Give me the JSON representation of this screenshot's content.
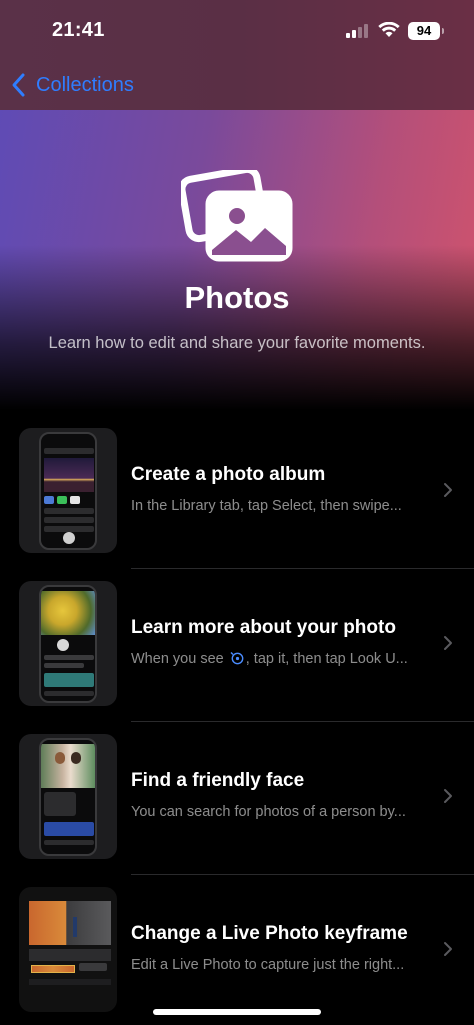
{
  "status_bar": {
    "time": "21:41",
    "battery_level": "94"
  },
  "nav": {
    "back_label": "Collections"
  },
  "hero": {
    "title": "Photos",
    "subtitle": "Learn how to edit and share your favorite moments.",
    "icon": "photos-icon"
  },
  "items": [
    {
      "title": "Create a photo album",
      "description": "In the Library tab, tap Select, then swipe..."
    },
    {
      "title": "Learn more about your photo",
      "description_before": "When you see",
      "description_after": ", tap it, then tap Look U...",
      "inline_icon": "visual-look-up-icon"
    },
    {
      "title": "Find a friendly face",
      "description": "You can search for photos of a person by..."
    },
    {
      "title": "Change a Live Photo keyframe",
      "description": "Edit a Live Photo to capture just the right..."
    }
  ],
  "colors": {
    "accent": "#2f7dff",
    "background": "#000000"
  }
}
